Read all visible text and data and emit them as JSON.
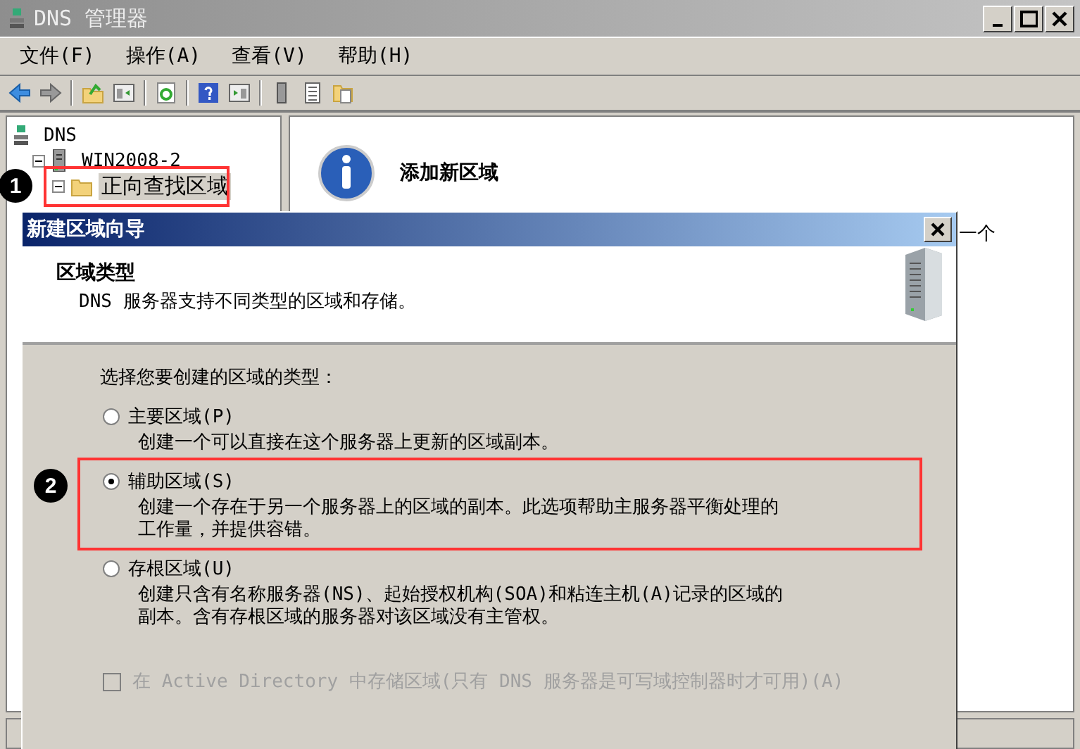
{
  "window": {
    "title": "DNS 管理器"
  },
  "menu": [
    "文件(F)",
    "操作(A)",
    "查看(V)",
    "帮助(H)"
  ],
  "tree": [
    {
      "label": "DNS",
      "children": [
        {
          "label": "WIN2008-2",
          "expanded": true,
          "children": [
            {
              "label": "正向查找区域",
              "expanded": true,
              "selected": true,
              "callout": "1"
            }
          ]
        }
      ]
    }
  ],
  "details": {
    "heading": "添加新区域",
    "fragment": "一个"
  },
  "dialog": {
    "title": "新建区域向导",
    "section_title": "区域类型",
    "section_subtitle": "DNS 服务器支持不同类型的区域和存储。",
    "prompt": "选择您要创建的区域的类型：",
    "options": [
      {
        "label": "主要区域(P)",
        "description": "创建一个可以直接在这个服务器上更新的区域副本。",
        "selected": false
      },
      {
        "label": "辅助区域(S)",
        "description": "创建一个存在于另一个服务器上的区域的副本。此选项帮助主服务器平衡处理的工作量，并提供容错。",
        "selected": true,
        "callout": "2"
      },
      {
        "label": "存根区域(U)",
        "description": "创建只含有名称服务器(NS)、起始授权机构(SOA)和粘连主机(A)记录的区域的副本。含有存根区域的服务器对该区域没有主管权。",
        "selected": false
      }
    ],
    "ad_checkbox": {
      "label": "在 Active Directory 中存储区域(只有 DNS 服务器是可写域控制器时才可用)(A)",
      "checked": false,
      "disabled": true
    }
  }
}
